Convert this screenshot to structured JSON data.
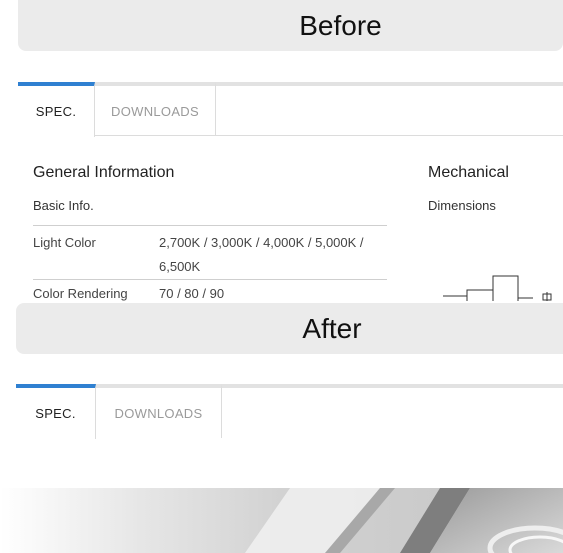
{
  "labels": {
    "before": "Before",
    "after": "After"
  },
  "tabs": [
    {
      "label": "SPEC."
    },
    {
      "label": "DOWNLOADS"
    }
  ],
  "spec": {
    "general_title": "General Information",
    "basic_info": "Basic Info.",
    "rows": [
      {
        "key": "Light Color",
        "value": "2,700K / 3,000K / 4,000K / 5,000K / 6,500K"
      },
      {
        "key": "Color Rendering",
        "value": "70 / 80 / 90"
      }
    ],
    "mechanical_title": "Mechanical",
    "dimensions": "Dimensions"
  },
  "colors": {
    "accent": "#2f80d1",
    "label_bg": "#ebebeb"
  }
}
